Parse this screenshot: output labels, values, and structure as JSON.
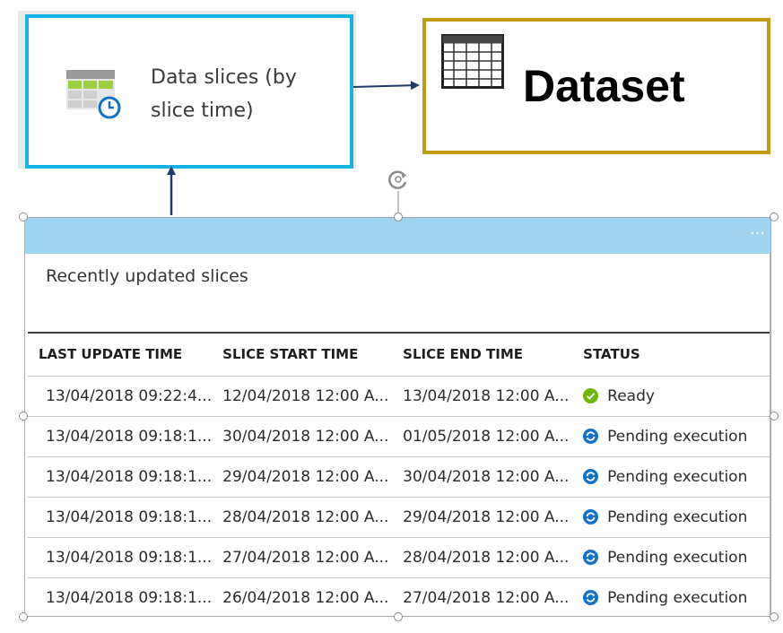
{
  "tile": {
    "label_line1": "Data slices (by",
    "label_line2": "slice time)",
    "icon": "calendar-clock-icon",
    "border_color": "#14b4e6"
  },
  "dataset": {
    "label": "Dataset",
    "icon": "table-grid-icon",
    "border_color": "#c09b0f"
  },
  "panel": {
    "title": "Recently updated slices",
    "header_color": "#9fd4f1",
    "more_label": "···",
    "columns": [
      "LAST UPDATE TIME",
      "SLICE START TIME",
      "SLICE END TIME",
      "STATUS"
    ],
    "rows": [
      {
        "last_update": "13/04/2018 09:22:4...",
        "start": "12/04/2018 12:00 A...",
        "end": "13/04/2018 12:00 A...",
        "status": "Ready",
        "status_icon": "check-circle-icon"
      },
      {
        "last_update": "13/04/2018 09:18:1...",
        "start": "30/04/2018 12:00 A...",
        "end": "01/05/2018 12:00 A...",
        "status": "Pending execution",
        "status_icon": "refresh-circle-icon"
      },
      {
        "last_update": "13/04/2018 09:18:1...",
        "start": "29/04/2018 12:00 A...",
        "end": "30/04/2018 12:00 A...",
        "status": "Pending execution",
        "status_icon": "refresh-circle-icon"
      },
      {
        "last_update": "13/04/2018 09:18:1...",
        "start": "28/04/2018 12:00 A...",
        "end": "29/04/2018 12:00 A...",
        "status": "Pending execution",
        "status_icon": "refresh-circle-icon"
      },
      {
        "last_update": "13/04/2018 09:18:1...",
        "start": "27/04/2018 12:00 A...",
        "end": "28/04/2018 12:00 A...",
        "status": "Pending execution",
        "status_icon": "refresh-circle-icon"
      },
      {
        "last_update": "13/04/2018 09:18:1...",
        "start": "26/04/2018 12:00 A...",
        "end": "27/04/2018 12:00 A...",
        "status": "Pending execution",
        "status_icon": "refresh-circle-icon"
      }
    ],
    "status_colors": {
      "ready": "#6bb700",
      "pending": "#0f72c8"
    }
  }
}
